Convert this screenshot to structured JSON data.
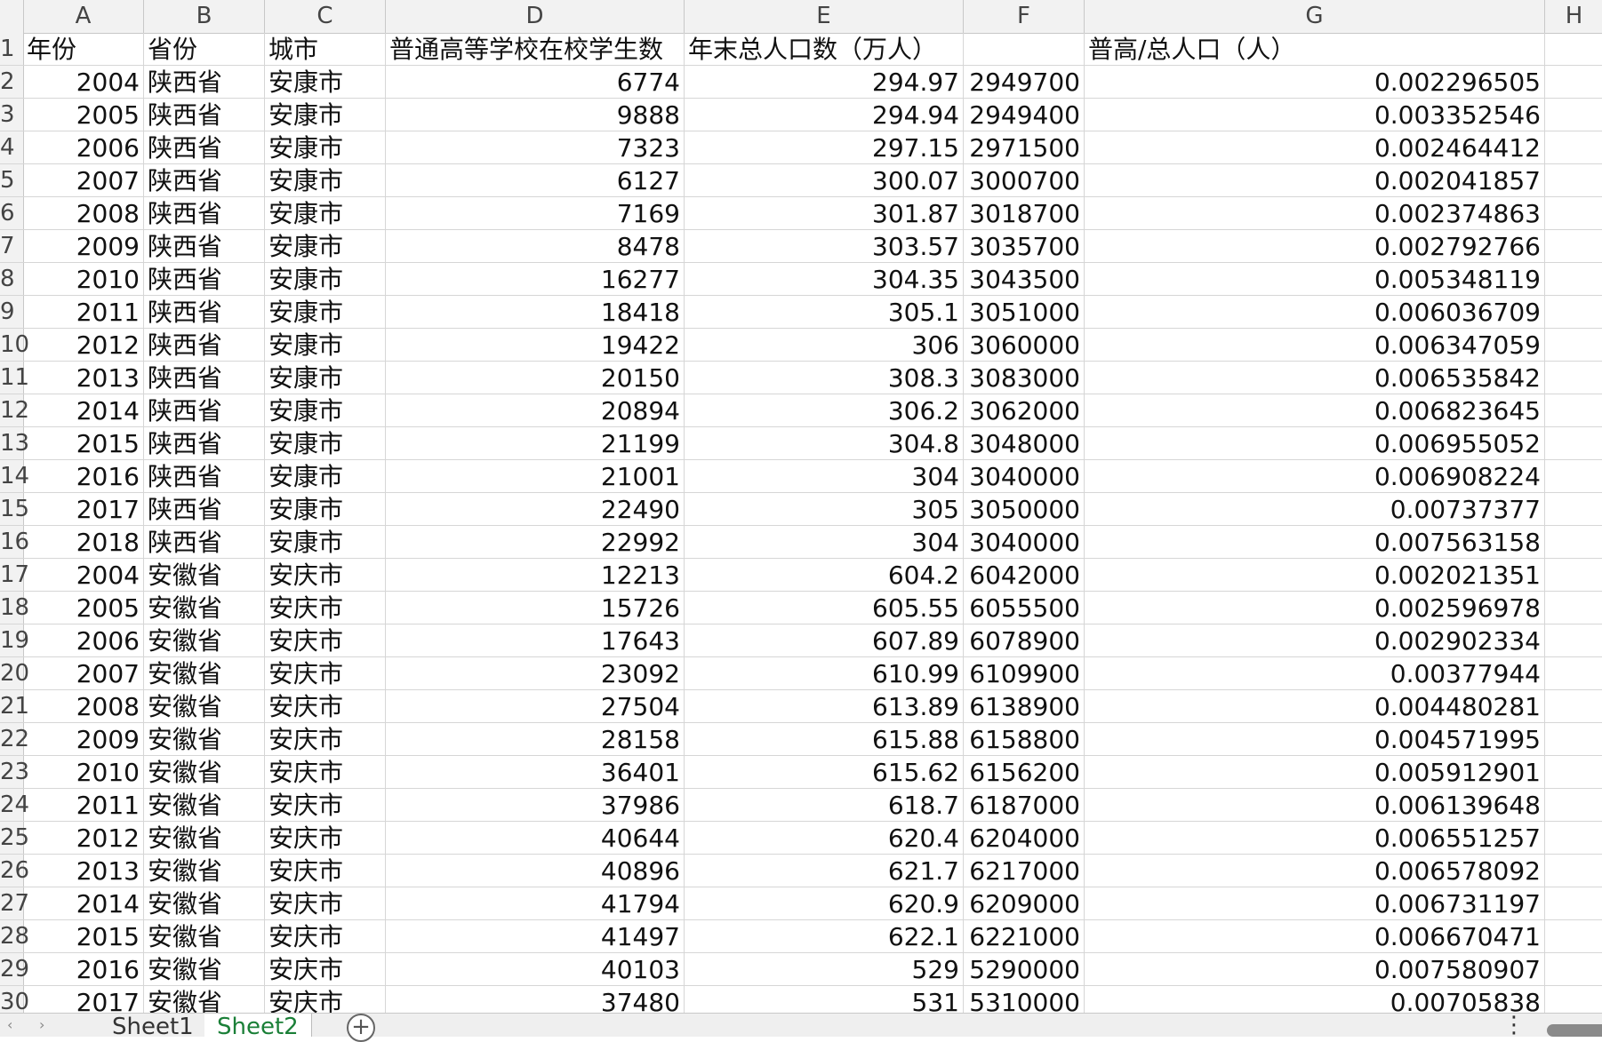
{
  "columns": [
    "A",
    "B",
    "C",
    "D",
    "E",
    "F",
    "G",
    "H"
  ],
  "row_numbers": [
    "1",
    "2",
    "3",
    "4",
    "5",
    "6",
    "7",
    "8",
    "9",
    "10",
    "11",
    "12",
    "13",
    "14",
    "15",
    "16",
    "17",
    "18",
    "19",
    "20",
    "21",
    "22",
    "23",
    "24",
    "25",
    "26",
    "27",
    "28",
    "29",
    "30"
  ],
  "header_row": [
    "年份",
    "省份",
    "城市",
    "普通高等学校在校学生数",
    "年末总人口数（万人）",
    "",
    "普高/总人口（人）",
    ""
  ],
  "rows": [
    [
      "2004",
      "陕西省",
      "安康市",
      "6774",
      "294.97",
      "2949700",
      "0.002296505"
    ],
    [
      "2005",
      "陕西省",
      "安康市",
      "9888",
      "294.94",
      "2949400",
      "0.003352546"
    ],
    [
      "2006",
      "陕西省",
      "安康市",
      "7323",
      "297.15",
      "2971500",
      "0.002464412"
    ],
    [
      "2007",
      "陕西省",
      "安康市",
      "6127",
      "300.07",
      "3000700",
      "0.002041857"
    ],
    [
      "2008",
      "陕西省",
      "安康市",
      "7169",
      "301.87",
      "3018700",
      "0.002374863"
    ],
    [
      "2009",
      "陕西省",
      "安康市",
      "8478",
      "303.57",
      "3035700",
      "0.002792766"
    ],
    [
      "2010",
      "陕西省",
      "安康市",
      "16277",
      "304.35",
      "3043500",
      "0.005348119"
    ],
    [
      "2011",
      "陕西省",
      "安康市",
      "18418",
      "305.1",
      "3051000",
      "0.006036709"
    ],
    [
      "2012",
      "陕西省",
      "安康市",
      "19422",
      "306",
      "3060000",
      "0.006347059"
    ],
    [
      "2013",
      "陕西省",
      "安康市",
      "20150",
      "308.3",
      "3083000",
      "0.006535842"
    ],
    [
      "2014",
      "陕西省",
      "安康市",
      "20894",
      "306.2",
      "3062000",
      "0.006823645"
    ],
    [
      "2015",
      "陕西省",
      "安康市",
      "21199",
      "304.8",
      "3048000",
      "0.006955052"
    ],
    [
      "2016",
      "陕西省",
      "安康市",
      "21001",
      "304",
      "3040000",
      "0.006908224"
    ],
    [
      "2017",
      "陕西省",
      "安康市",
      "22490",
      "305",
      "3050000",
      "0.00737377"
    ],
    [
      "2018",
      "陕西省",
      "安康市",
      "22992",
      "304",
      "3040000",
      "0.007563158"
    ],
    [
      "2004",
      "安徽省",
      "安庆市",
      "12213",
      "604.2",
      "6042000",
      "0.002021351"
    ],
    [
      "2005",
      "安徽省",
      "安庆市",
      "15726",
      "605.55",
      "6055500",
      "0.002596978"
    ],
    [
      "2006",
      "安徽省",
      "安庆市",
      "17643",
      "607.89",
      "6078900",
      "0.002902334"
    ],
    [
      "2007",
      "安徽省",
      "安庆市",
      "23092",
      "610.99",
      "6109900",
      "0.00377944"
    ],
    [
      "2008",
      "安徽省",
      "安庆市",
      "27504",
      "613.89",
      "6138900",
      "0.004480281"
    ],
    [
      "2009",
      "安徽省",
      "安庆市",
      "28158",
      "615.88",
      "6158800",
      "0.004571995"
    ],
    [
      "2010",
      "安徽省",
      "安庆市",
      "36401",
      "615.62",
      "6156200",
      "0.005912901"
    ],
    [
      "2011",
      "安徽省",
      "安庆市",
      "37986",
      "618.7",
      "6187000",
      "0.006139648"
    ],
    [
      "2012",
      "安徽省",
      "安庆市",
      "40644",
      "620.4",
      "6204000",
      "0.006551257"
    ],
    [
      "2013",
      "安徽省",
      "安庆市",
      "40896",
      "621.7",
      "6217000",
      "0.006578092"
    ],
    [
      "2014",
      "安徽省",
      "安庆市",
      "41794",
      "620.9",
      "6209000",
      "0.006731197"
    ],
    [
      "2015",
      "安徽省",
      "安庆市",
      "41497",
      "622.1",
      "6221000",
      "0.006670471"
    ],
    [
      "2016",
      "安徽省",
      "安庆市",
      "40103",
      "529",
      "5290000",
      "0.007580907"
    ],
    [
      "2017",
      "安徽省",
      "安庆市",
      "37480",
      "531",
      "5310000",
      "0.00705838"
    ]
  ],
  "sheet_tabs": [
    {
      "label": "Sheet1",
      "active": false
    },
    {
      "label": "Sheet2",
      "active": true
    }
  ],
  "add_sheet_symbol": "+",
  "more_symbol": "⋮",
  "colors": {
    "active_tab": "#1a7f37",
    "header_bg": "#f2f2f2",
    "grid_line": "#d6d6d6"
  }
}
